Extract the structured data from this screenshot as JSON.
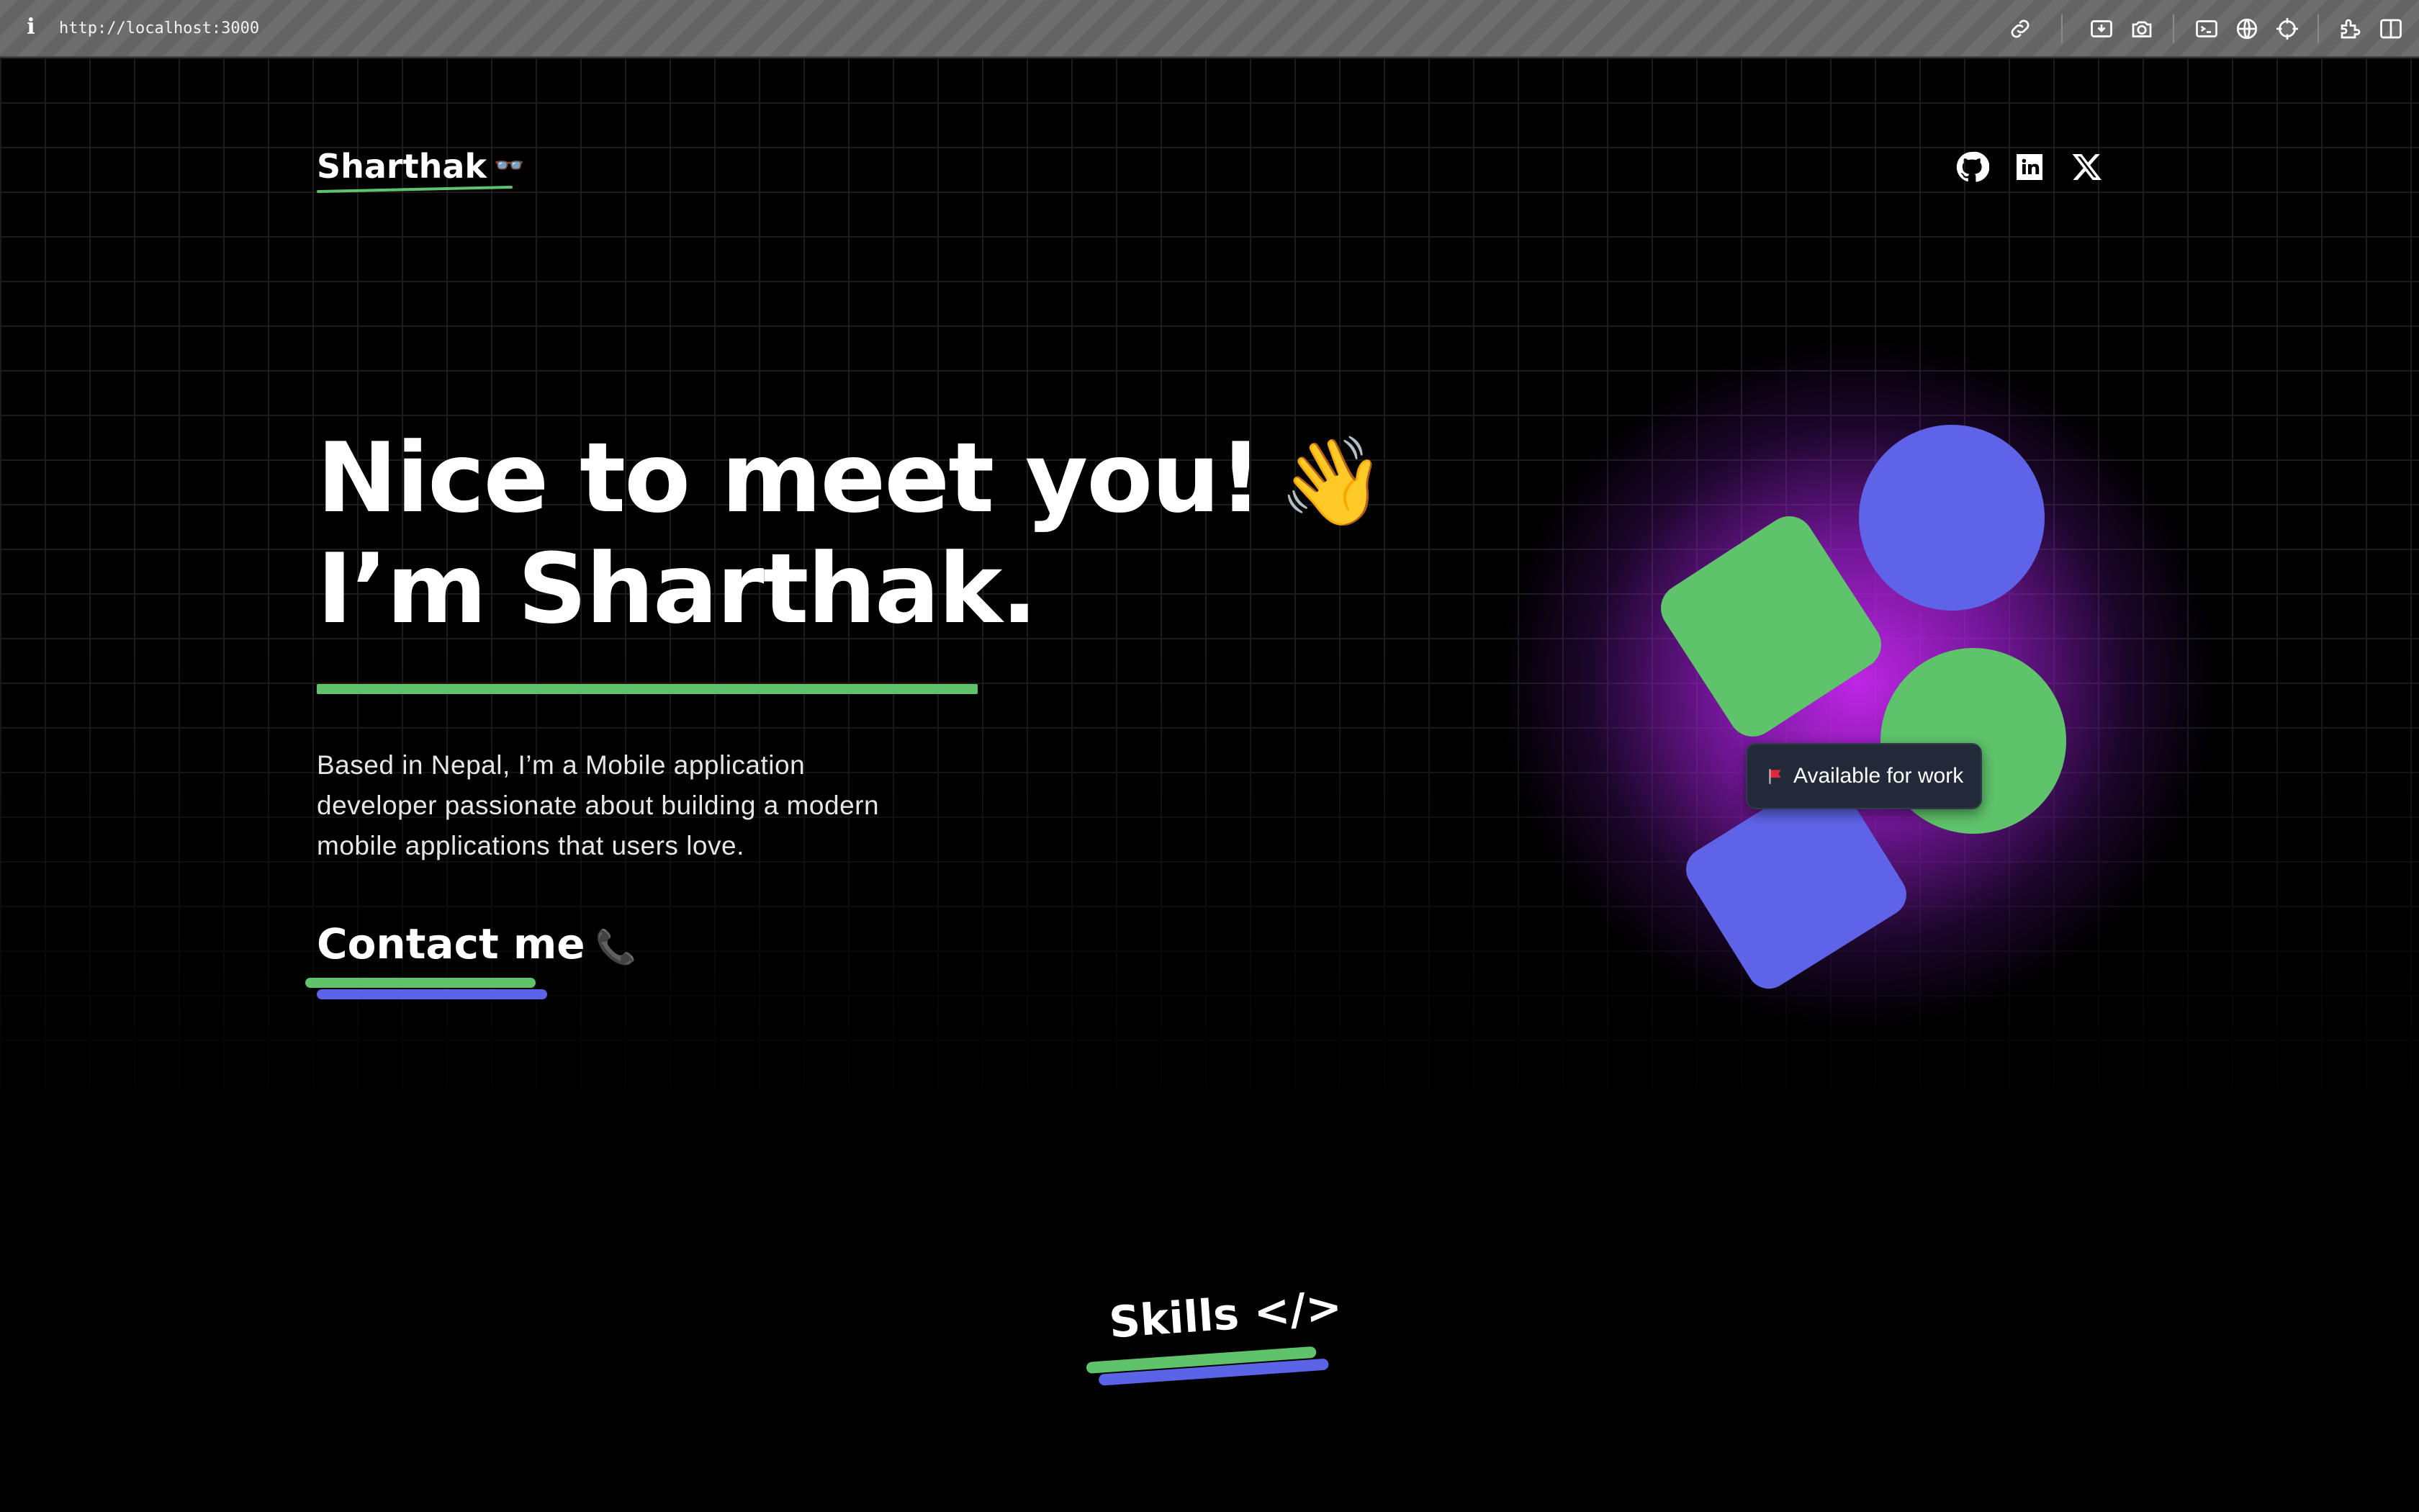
{
  "browser": {
    "url": "http://localhost:3000",
    "info_glyph": "i",
    "toolbar_icons": [
      "link-icon",
      "install-icon",
      "screenshot-icon",
      "terminal-icon",
      "globe-icon",
      "crosshair-icon",
      "extensions-icon",
      "sidebar-icon"
    ]
  },
  "header": {
    "logo_text": "Sharthak",
    "logo_emoji": "👓",
    "social_icons": [
      "github-icon",
      "linkedin-icon",
      "x-icon"
    ]
  },
  "hero": {
    "line1": "Nice to meet you!",
    "wave_emoji": "👋",
    "line2": "I’m Sharthak.",
    "bio": "Based in Nepal, I’m a Mobile application developer passionate about building a modern mobile applications that users love.",
    "contact_label": "Contact me",
    "contact_emoji": "📞"
  },
  "illustration": {
    "badge_text": "Available for work",
    "accent_green": "#5ec36a",
    "accent_blue": "#5e63e8",
    "glow_color": "#c028f0"
  },
  "skills": {
    "title": "Skills </>"
  },
  "colors": {
    "background": "#000000",
    "text": "#ffffff",
    "underline_green": "#5ec36a",
    "underline_blue": "#5b63e6"
  }
}
